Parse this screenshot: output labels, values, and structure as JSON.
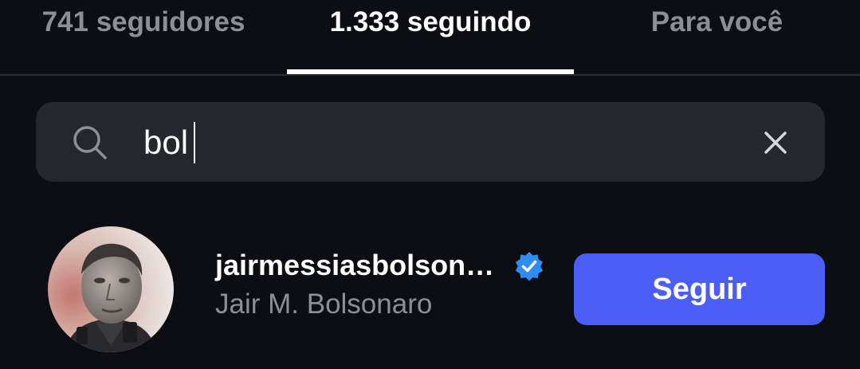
{
  "tabs": [
    {
      "label": "741 seguidores",
      "active": false
    },
    {
      "label": "1.333 seguindo",
      "active": true
    },
    {
      "label": "Para você",
      "active": false
    }
  ],
  "search": {
    "value": "bol",
    "icon": "search-icon",
    "clear_icon": "close-icon"
  },
  "results": [
    {
      "username": "jairmessiasbolson…",
      "verified": true,
      "display_name": "Jair M. Bolsonaro",
      "follow_label": "Seguir"
    }
  ],
  "colors": {
    "background": "#0c0e13",
    "search_bg": "#24272e",
    "accent": "#4b5df5",
    "verified": "#2f8cf0",
    "muted_text": "#8b8f97"
  }
}
